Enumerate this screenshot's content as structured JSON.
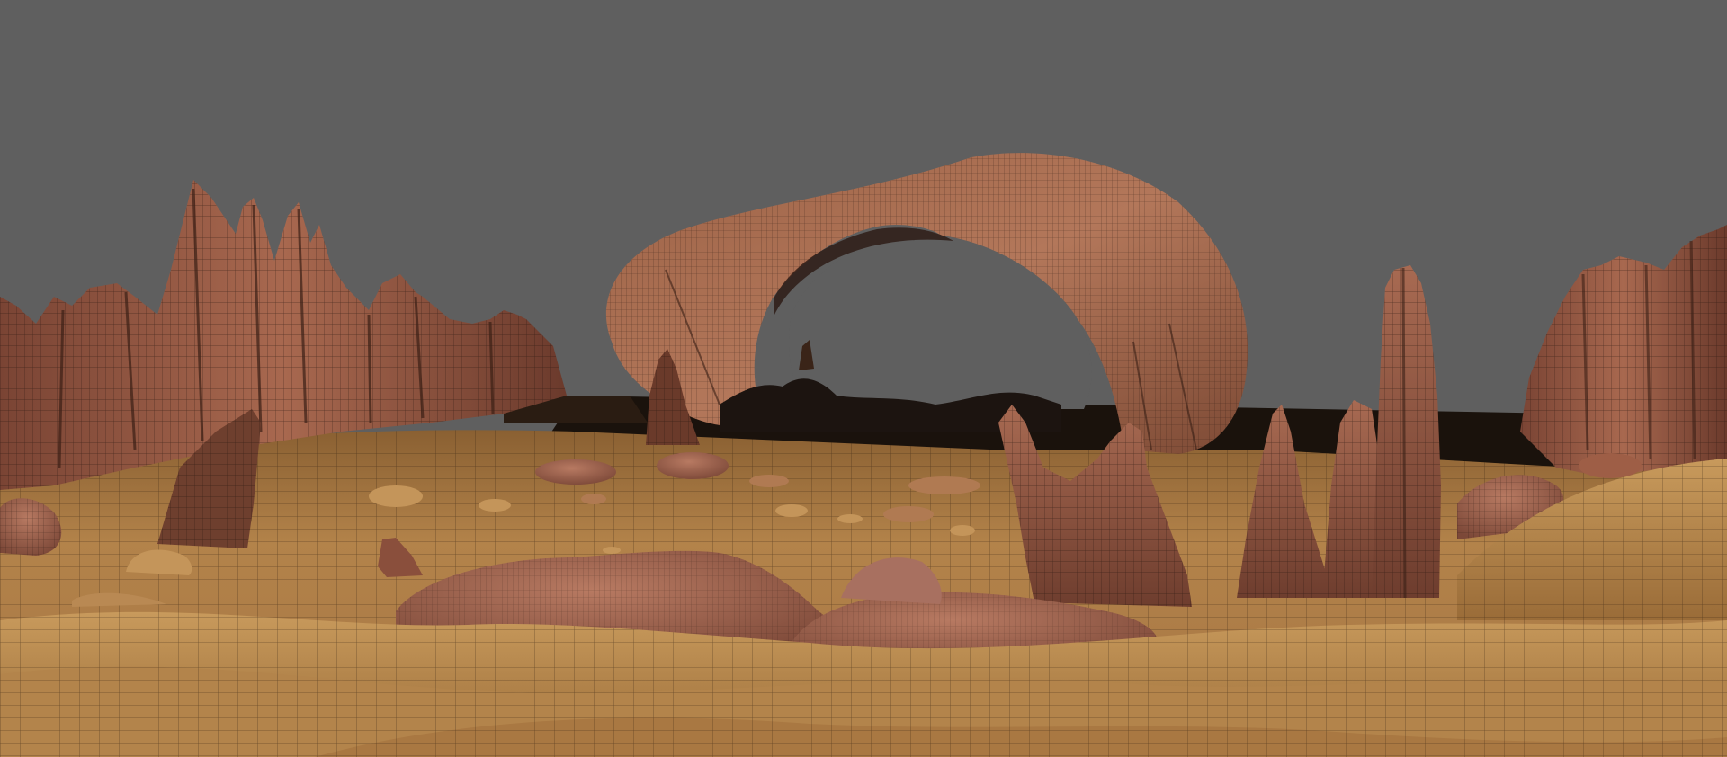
{
  "viewport": {
    "background_color": "#5f5f5f",
    "render_mode": "wireframe-on-shaded"
  },
  "palette": {
    "sand_light": "#c8955a",
    "sand_mid": "#a8773e",
    "sand_dark": "#7a5428",
    "rock_light": "#b47358",
    "rock_mid": "#8e5240",
    "rock_dark": "#5a3126",
    "shadow": "#231610",
    "wire": "#1e140c"
  },
  "scene_objects": [
    "left-rock-spires",
    "stone-arch",
    "right-rock-cliff",
    "tall-stone-pillar",
    "central-rock-spires",
    "boulders",
    "sand-dunes"
  ]
}
